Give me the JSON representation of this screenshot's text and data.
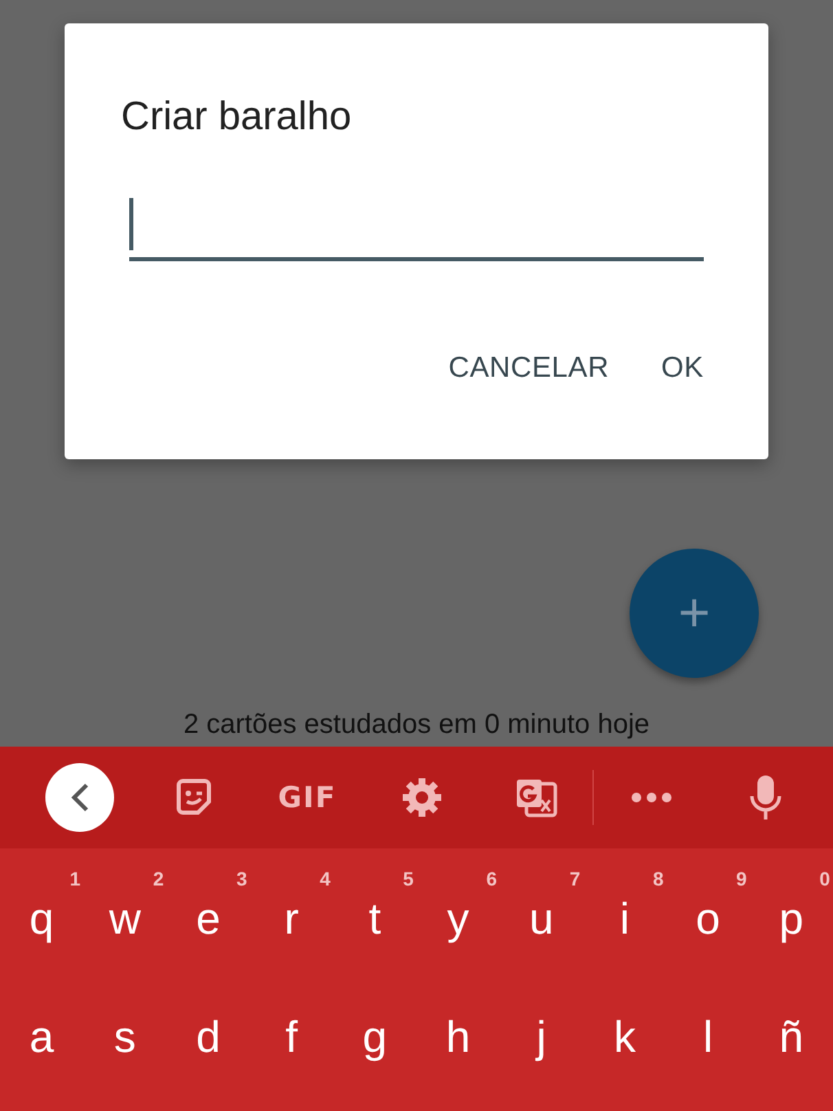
{
  "dialog": {
    "title": "Criar baralho",
    "field": {
      "focused": true
    },
    "buttons": [
      {
        "label": "CANCELAR"
      },
      {
        "label": "OK"
      }
    ]
  },
  "fab": {
    "label": "+"
  },
  "status_text": "2 cartões estudados em 0 minuto hoje",
  "keyboard": {
    "toolbar": [
      {
        "kind": "back"
      },
      {
        "kind": "sticker"
      },
      {
        "kind": "text",
        "label": "GIF"
      },
      {
        "kind": "settings"
      },
      {
        "kind": "translate"
      },
      {
        "kind": "divider"
      },
      {
        "kind": "more"
      },
      {
        "kind": "mic"
      }
    ],
    "rows": [
      [
        {
          "key": "q",
          "hint": "1"
        },
        {
          "key": "w",
          "hint": "2"
        },
        {
          "key": "e",
          "hint": "3"
        },
        {
          "key": "r",
          "hint": "4"
        },
        {
          "key": "t",
          "hint": "5"
        },
        {
          "key": "y",
          "hint": "6"
        },
        {
          "key": "u",
          "hint": "7"
        },
        {
          "key": "i",
          "hint": "8"
        },
        {
          "key": "o",
          "hint": "9"
        },
        {
          "key": "p",
          "hint": "0"
        }
      ],
      [
        {
          "key": "a"
        },
        {
          "key": "s"
        },
        {
          "key": "d"
        },
        {
          "key": "f"
        },
        {
          "key": "g"
        },
        {
          "key": "h"
        },
        {
          "key": "j"
        },
        {
          "key": "k"
        },
        {
          "key": "l"
        },
        {
          "key": "ñ"
        }
      ]
    ]
  }
}
